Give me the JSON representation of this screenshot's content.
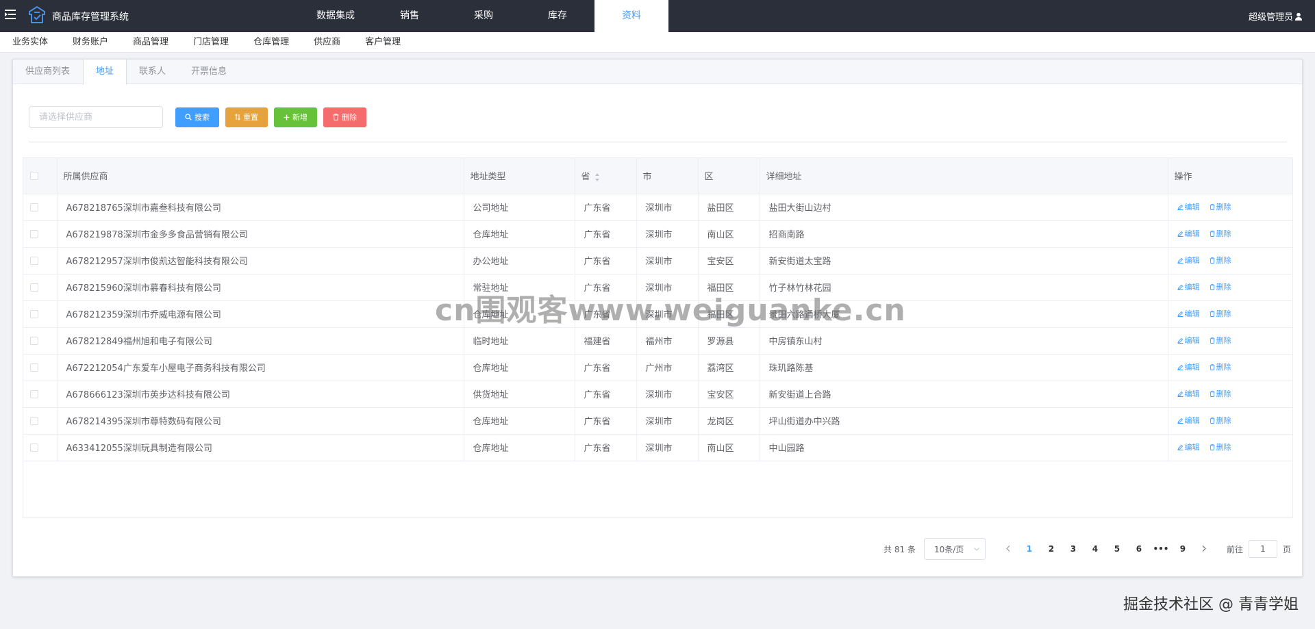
{
  "header": {
    "app_title": "商品库存管理系统",
    "nav": [
      {
        "label": "数据集成",
        "active": false
      },
      {
        "label": "销售",
        "active": false
      },
      {
        "label": "采购",
        "active": false
      },
      {
        "label": "库存",
        "active": false
      },
      {
        "label": "资料",
        "active": true
      }
    ],
    "user": "超级管理员"
  },
  "subnav": [
    "业务实体",
    "财务账户",
    "商品管理",
    "门店管理",
    "仓库管理",
    "供应商",
    "客户管理"
  ],
  "tabs": [
    {
      "label": "供应商列表",
      "active": false
    },
    {
      "label": "地址",
      "active": true
    },
    {
      "label": "联系人",
      "active": false
    },
    {
      "label": "开票信息",
      "active": false
    }
  ],
  "toolbar": {
    "search_placeholder": "请选择供应商",
    "search_label": "搜索",
    "reset_label": "重置",
    "add_label": "新增",
    "delete_label": "删除"
  },
  "table": {
    "columns": [
      "所属供应商",
      "地址类型",
      "省",
      "市",
      "区",
      "详细地址",
      "操作"
    ],
    "edit_label": "编辑",
    "delete_label": "删除",
    "rows": [
      [
        "A678218765深圳市嘉叁科技有限公司",
        "公司地址",
        "广东省",
        "深圳市",
        "盐田区",
        "盐田大街山边村"
      ],
      [
        "A678219878深圳市金多多食品营销有限公司",
        "仓库地址",
        "广东省",
        "深圳市",
        "南山区",
        "招商南路"
      ],
      [
        "A678212957深圳市俊凯达智能科技有限公司",
        "办公地址",
        "广东省",
        "深圳市",
        "宝安区",
        "新安街道太宝路"
      ],
      [
        "A678215960深圳市慕春科技有限公司",
        "常驻地址",
        "广东省",
        "深圳市",
        "福田区",
        "竹子林竹林花园"
      ],
      [
        "A678212359深圳市乔威电源有限公司",
        "仓库地址",
        "广东省",
        "深圳市",
        "福田区",
        "景田六路通桥大厦"
      ],
      [
        "A678212849福州旭和电子有限公司",
        "临时地址",
        "福建省",
        "福州市",
        "罗源县",
        "中房镇东山村"
      ],
      [
        "A672212054广东爱车小屋电子商务科技有限公司",
        "仓库地址",
        "广东省",
        "广州市",
        "荔湾区",
        "珠玑路陈基"
      ],
      [
        "A678666123深圳市英步达科技有限公司",
        "供货地址",
        "广东省",
        "深圳市",
        "宝安区",
        "新安街道上合路"
      ],
      [
        "A678214395深圳市尊特数码有限公司",
        "仓库地址",
        "广东省",
        "深圳市",
        "龙岗区",
        "坪山街道办中兴路"
      ],
      [
        "A633412055深圳玩具制造有限公司",
        "仓库地址",
        "广东省",
        "深圳市",
        "南山区",
        "中山园路"
      ]
    ]
  },
  "pagination": {
    "total": "共 81 条",
    "page_size": "10条/页",
    "pages": [
      "1",
      "2",
      "3",
      "4",
      "5",
      "6",
      "•••",
      "9"
    ],
    "current": "1",
    "goto_prefix": "前往",
    "goto_value": "1",
    "goto_suffix": "页"
  },
  "watermark": "cn围观客www.weiguanke.cn",
  "credit": "掘金技术社区 @ 青青学姐",
  "colors": {
    "header_bg": "#2b2f3a",
    "primary": "#409eff",
    "warning": "#e6a23c",
    "success": "#67c23a",
    "danger": "#f56c6c"
  }
}
